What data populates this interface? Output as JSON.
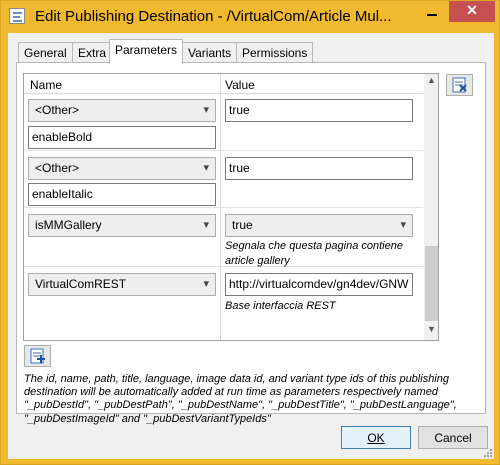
{
  "window": {
    "title": "Edit Publishing Destination - /VirtualCom/Article Mul...",
    "close_glyph": "✕",
    "close_color": "#c75050"
  },
  "tabs": [
    {
      "label": "General"
    },
    {
      "label": "Extra"
    },
    {
      "label": "Parameters",
      "active": true
    },
    {
      "label": "Variants"
    },
    {
      "label": "Permissions"
    }
  ],
  "grid": {
    "headers": {
      "name": "Name",
      "value": "Value"
    },
    "rows": [
      {
        "combo": "<Other>",
        "name_value": "enableBold",
        "value": "true"
      },
      {
        "combo": "<Other>",
        "name_value": "enableItalic",
        "value": "true"
      },
      {
        "combo": "isMMGallery",
        "value": "true",
        "description": "Segnala che questa pagina contiene article gallery"
      },
      {
        "combo": "VirtualComREST",
        "value": "http://virtualcomdev/gn4dev/GNW",
        "description": "Base interfaccia REST"
      }
    ]
  },
  "icons": {
    "delete": "delete-parameter-icon",
    "add": "add-parameter-icon",
    "chevron": "▾"
  },
  "note": "The id, name, path, title, language, image data id, and variant type ids of this publishing destination will be automatically added at run time as parameters respectively named \"_pubDestId\", \"_pubDestPath\", \"_pubDestName\", \"_pubDestTitle\", \"_pubDestLanguage\", \"_pubDestImageId\" and \"_pubDestVariantTypeIds\"",
  "buttons": {
    "ok": "OK",
    "cancel": "Cancel"
  },
  "colors": {
    "title_bar": "#f0b92f",
    "accent": "#3c7fb1"
  }
}
